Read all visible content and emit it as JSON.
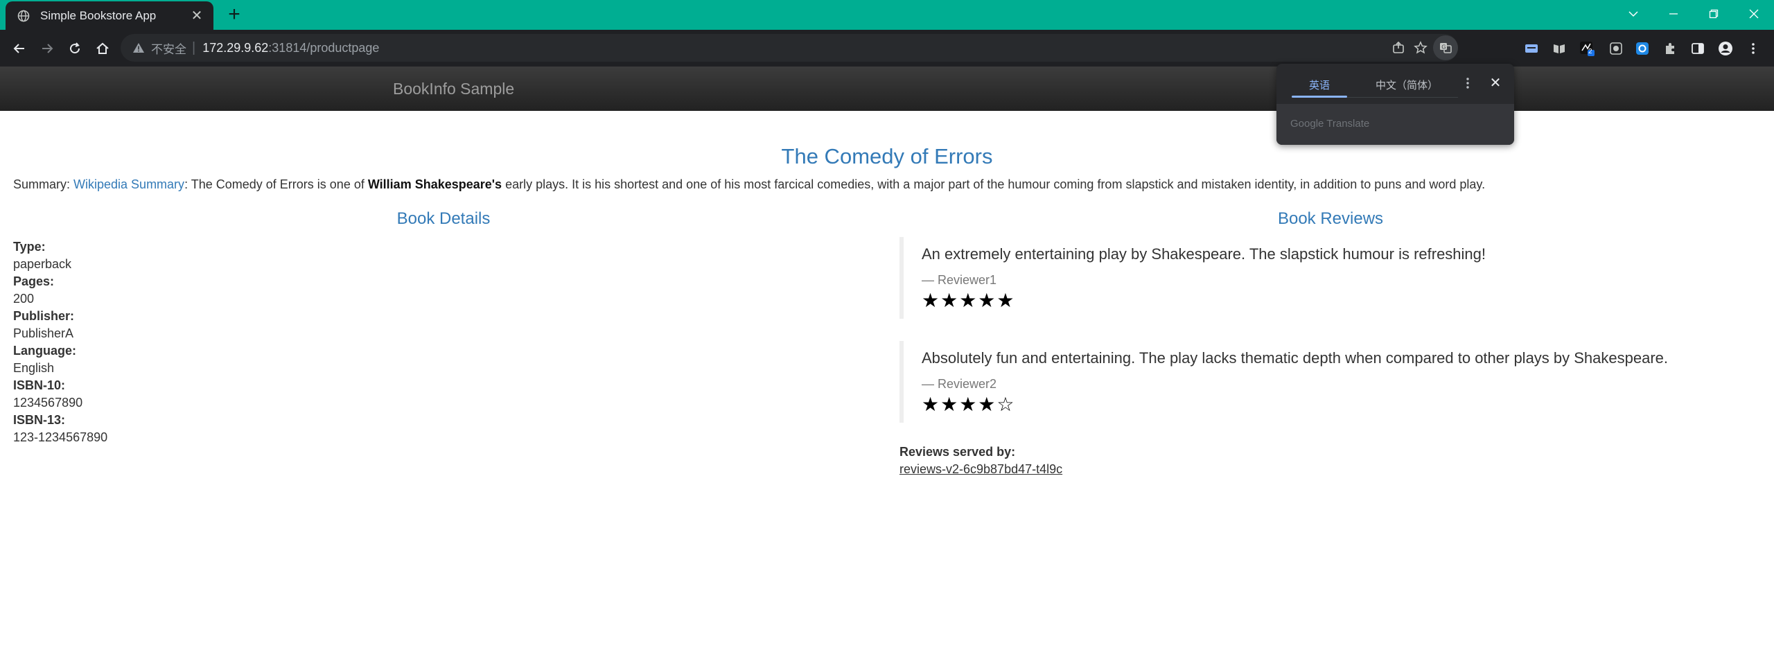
{
  "browser": {
    "tab_title": "Simple Bookstore App",
    "address_insecure_label": "不安全",
    "address_host": "172.29.9.62",
    "address_rest": ":31814/productpage",
    "extension_badge": "2"
  },
  "translate_popup": {
    "tab_source": "英语",
    "tab_target": "中文（简体）",
    "footer": "Google Translate"
  },
  "page": {
    "brand": "BookInfo Sample",
    "title": "The Comedy of Errors",
    "summary": {
      "prefix": "Summary: ",
      "link_text": "Wikipedia Summary",
      "middle": ": The Comedy of Errors is one of ",
      "bold": "William Shakespeare's",
      "suffix": " early plays. It is his shortest and one of his most farcical comedies, with a major part of the humour coming from slapstick and mistaken identity, in addition to puns and word play."
    },
    "details_title": "Book Details",
    "details": [
      {
        "label": "Type:",
        "value": "paperback"
      },
      {
        "label": "Pages:",
        "value": "200"
      },
      {
        "label": "Publisher:",
        "value": "PublisherA"
      },
      {
        "label": "Language:",
        "value": "English"
      },
      {
        "label": "ISBN-10:",
        "value": "1234567890"
      },
      {
        "label": "ISBN-13:",
        "value": "123-1234567890"
      }
    ],
    "reviews_title": "Book Reviews",
    "reviews": [
      {
        "text": "An extremely entertaining play by Shakespeare. The slapstick humour is refreshing!",
        "reviewer": "— Reviewer1",
        "stars": "★★★★★",
        "rating": 5
      },
      {
        "text": "Absolutely fun and entertaining. The play lacks thematic depth when compared to other plays by Shakespeare.",
        "reviewer": "— Reviewer2",
        "stars": "★★★★☆",
        "rating": 4
      }
    ],
    "served_by_label": "Reviews served by:",
    "served_by_value": "reviews-v2-6c9b87bd47-t4l9c"
  },
  "colors": {
    "accent": "#00ae92",
    "link": "#337ab7",
    "chrome_dark": "#1f2023"
  }
}
